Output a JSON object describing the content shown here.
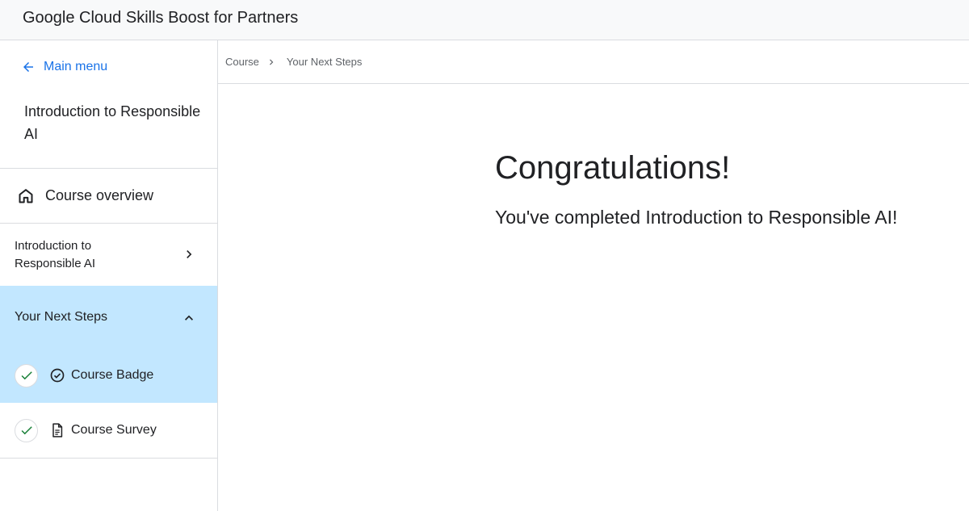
{
  "header": {
    "app_title": "Google Cloud Skills Boost for Partners"
  },
  "sidebar": {
    "main_menu_label": "Main menu",
    "course_title": "Introduction to Responsible AI",
    "overview_label": "Course overview",
    "module_label": "Introduction to Responsible AI",
    "next_steps_label": "Your Next Steps",
    "items": [
      {
        "label": "Course Badge",
        "completed": true,
        "active": true,
        "icon": "badge-check-icon"
      },
      {
        "label": "Course Survey",
        "completed": true,
        "active": false,
        "icon": "document-icon"
      }
    ]
  },
  "breadcrumb": {
    "parent": "Course",
    "current": "Your Next Steps"
  },
  "main": {
    "heading": "Congratulations!",
    "message": "You've completed Introduction to Responsible AI!"
  },
  "colors": {
    "accent": "#1a73e8",
    "selected_bg": "#c2e7ff",
    "check": "#188038"
  }
}
